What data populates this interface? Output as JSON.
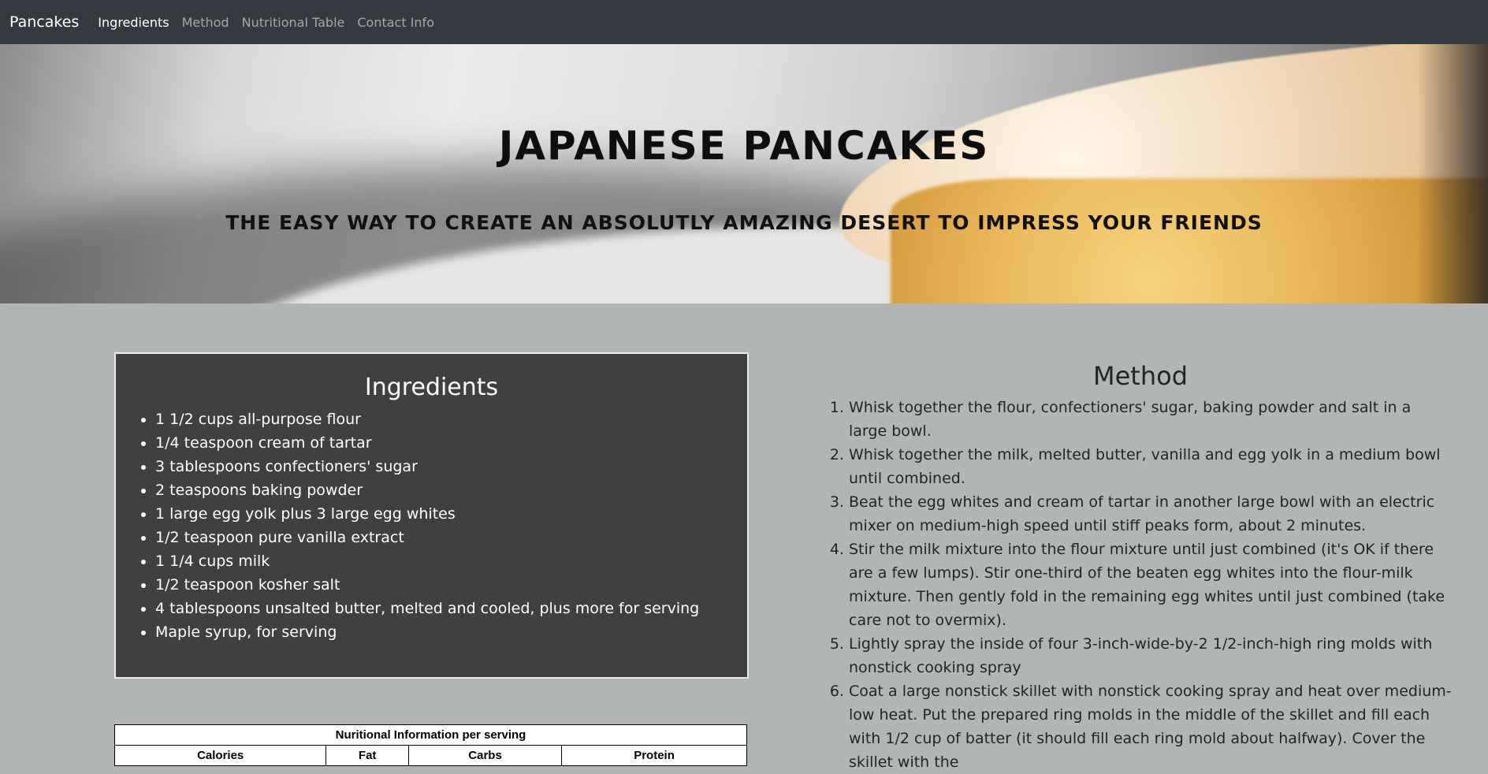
{
  "navbar": {
    "brand": "Pancakes",
    "links": [
      "Ingredients",
      "Method",
      "Nutritional Table",
      "Contact Info"
    ],
    "active_link": "Ingredients"
  },
  "hero": {
    "title": "Japanese Pancakes",
    "subtitle": "The easy way to create an absolutly amazing desert to impress your friends"
  },
  "ingredients": {
    "title": "Ingredients",
    "items": [
      "1 1/2 cups all-purpose flour",
      "1/4 teaspoon cream of tartar",
      "3 tablespoons confectioners' sugar",
      "2 teaspoons baking powder",
      "1 large egg yolk plus 3 large egg whites",
      "1/2 teaspoon pure vanilla extract",
      "1 1/4 cups milk",
      "1/2 teaspoon kosher salt",
      "4 tablespoons unsalted butter, melted and cooled, plus more for serving",
      "Maple syrup, for serving"
    ]
  },
  "nutrition": {
    "caption": "Nuritional Information per serving",
    "headers": [
      "Calories",
      "Fat",
      "Carbs",
      "Protein"
    ]
  },
  "method": {
    "title": "Method",
    "steps": [
      "Whisk together the flour, confectioners' sugar, baking powder and salt in a large bowl.",
      "Whisk together the milk, melted butter, vanilla and egg yolk in a medium bowl until combined.",
      "Beat the egg whites and cream of tartar in another large bowl with an electric mixer on medium-high speed until stiff peaks form, about 2 minutes.",
      "Stir the milk mixture into the flour mixture until just combined (it's OK if there are a few lumps). Stir one-third of the beaten egg whites into the flour-milk mixture. Then gently fold in the remaining egg whites until just combined (take care not to overmix).",
      "Lightly spray the inside of four 3-inch-wide-by-2 1/2-inch-high ring molds with nonstick cooking spray",
      "Coat a large nonstick skillet with nonstick cooking spray and heat over medium-low heat. Put the prepared ring molds in the middle of the skillet and fill each with 1/2 cup of batter (it should fill each ring mold about halfway). Cover the skillet with the"
    ]
  }
}
